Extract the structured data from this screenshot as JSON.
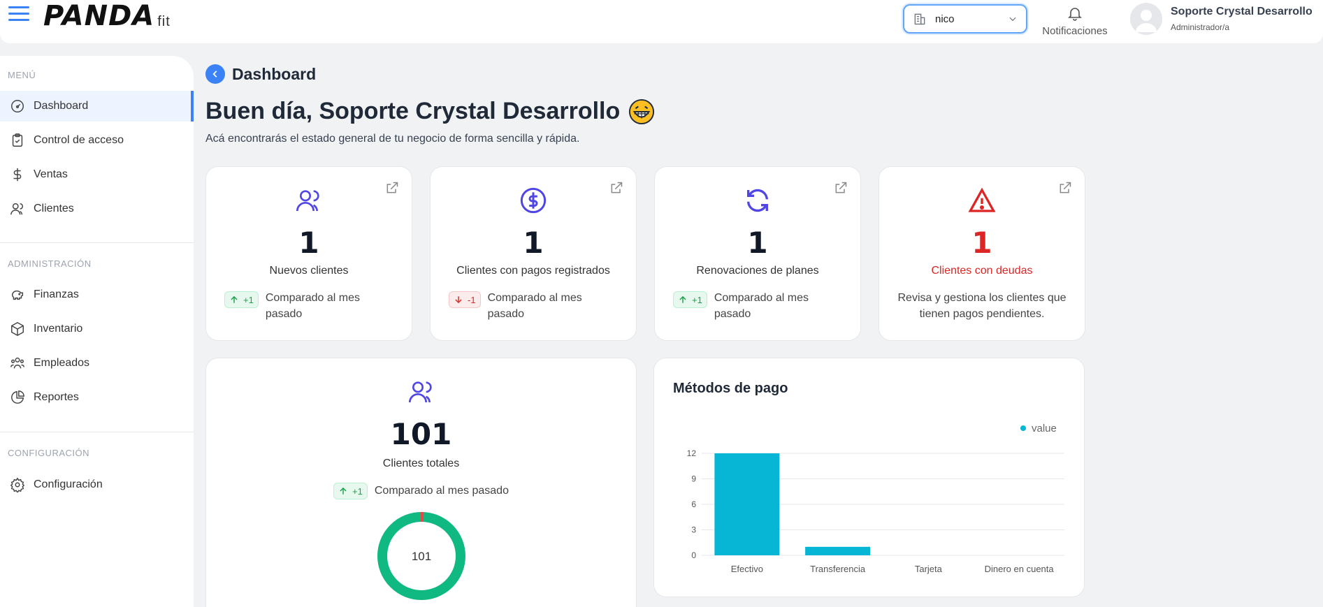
{
  "header": {
    "logo_main": "PANDA",
    "logo_sub": "fit",
    "branch_value": "nico",
    "notifications_label": "Notificaciones",
    "user_name": "Soporte Crystal Desarrollo",
    "user_role": "Administrador/a"
  },
  "sidebar": {
    "sections": [
      {
        "title": "MENÚ",
        "items": [
          {
            "label": "Dashboard",
            "icon": "dashboard-icon",
            "active": true
          },
          {
            "label": "Control de acceso",
            "icon": "clipboard-check-icon"
          },
          {
            "label": "Ventas",
            "icon": "dollar-icon"
          },
          {
            "label": "Clientes",
            "icon": "users-icon"
          }
        ]
      },
      {
        "title": "ADMINISTRACIÓN",
        "items": [
          {
            "label": "Finanzas",
            "icon": "piggy-bank-icon"
          },
          {
            "label": "Inventario",
            "icon": "box-icon"
          },
          {
            "label": "Empleados",
            "icon": "team-icon"
          },
          {
            "label": "Reportes",
            "icon": "pie-chart-icon"
          }
        ]
      },
      {
        "title": "CONFIGURACIÓN",
        "items": [
          {
            "label": "Configuración",
            "icon": "gear-icon"
          }
        ]
      }
    ]
  },
  "main": {
    "breadcrumb": "Dashboard",
    "greeting": "Buen día, Soporte Crystal Desarrollo",
    "subtitle": "Acá encontrarás el estado general de tu negocio de forma sencilla y rápida.",
    "stats": [
      {
        "value": "1",
        "label": "Nuevos clientes",
        "badge": "+1",
        "trend": "up",
        "compare": "Comparado al mes pasado",
        "icon": "users-icon",
        "color": "#4f46e5"
      },
      {
        "value": "1",
        "label": "Clientes con pagos registrados",
        "badge": "-1",
        "trend": "down",
        "compare": "Comparado al mes pasado",
        "icon": "dollar-circle-icon",
        "color": "#4f46e5"
      },
      {
        "value": "1",
        "label": "Renovaciones de planes",
        "badge": "+1",
        "trend": "up",
        "compare": "Comparado al mes pasado",
        "icon": "refresh-icon",
        "color": "#4f46e5"
      },
      {
        "value": "1",
        "label": "Clientes con deudas",
        "description": "Revisa y gestiona los clientes que tienen pagos pendientes.",
        "icon": "alert-triangle-icon",
        "color": "#dc2626"
      }
    ],
    "total_clients": {
      "value": "101",
      "label": "Clientes totales",
      "badge": "+1",
      "compare": "Comparado al mes pasado",
      "donut_center": "101",
      "donut_colors": [
        "#10b981",
        "#ef4444"
      ]
    },
    "payment_methods": {
      "title": "Métodos de pago"
    }
  },
  "chart_data": {
    "type": "bar",
    "title": "Métodos de pago",
    "categories": [
      "Efectivo",
      "Transferencia",
      "Tarjeta",
      "Dinero en cuenta"
    ],
    "series": [
      {
        "name": "value",
        "values": [
          12,
          1,
          0,
          0
        ],
        "color": "#06b6d4"
      }
    ],
    "yticks": [
      0,
      3,
      6,
      9,
      12
    ],
    "ylim": [
      0,
      12
    ],
    "legend": "top-right",
    "grid": true
  }
}
